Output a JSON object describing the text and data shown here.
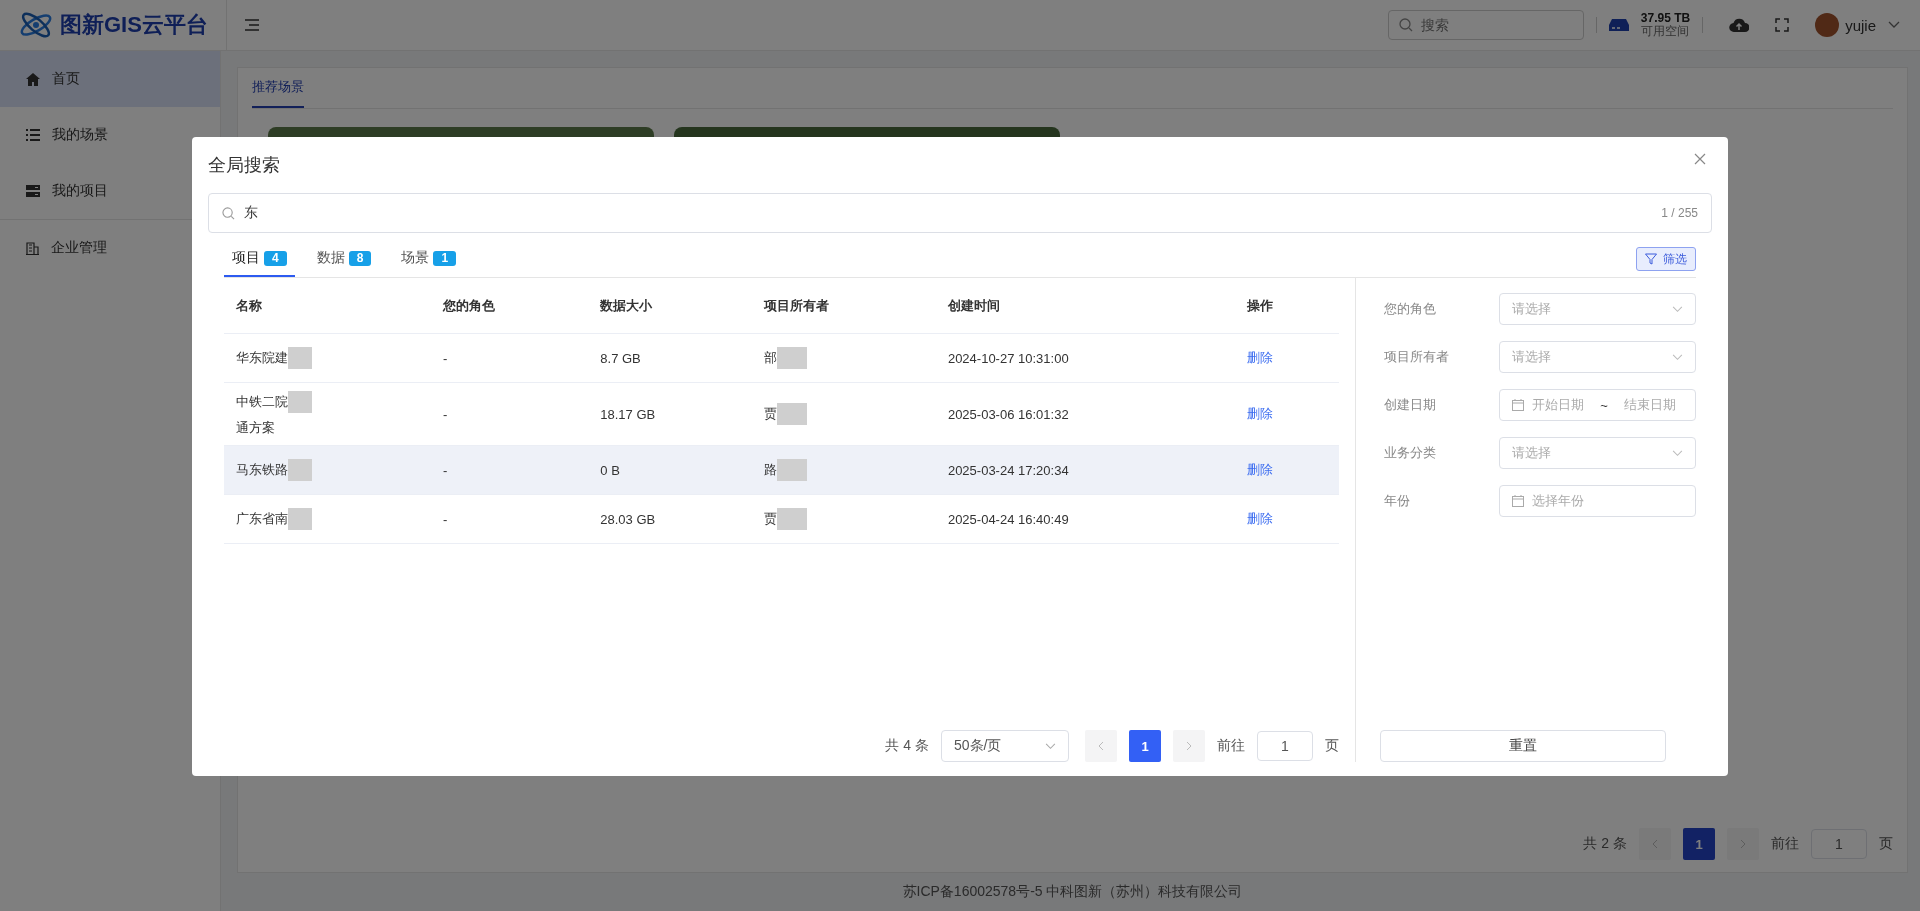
{
  "header": {
    "logo": "图新GIS云平台",
    "search_placeholder": "搜索",
    "storage_value": "37.95 TB",
    "storage_label": "可用空间",
    "user": "yujie"
  },
  "sidebar": {
    "items": [
      {
        "label": "首页",
        "selected": true
      },
      {
        "label": "我的场景",
        "selected": false
      },
      {
        "label": "我的项目",
        "selected": false
      },
      {
        "label": "企业管理",
        "selected": false
      }
    ]
  },
  "page": {
    "tabs": [
      {
        "label": "推荐场景",
        "selected": true
      }
    ],
    "pagination": {
      "total": "共 2 条",
      "current": "1",
      "goto_label": "前往",
      "goto_value": "1",
      "page_unit": "页"
    },
    "footer": "苏ICP备16002578号-5 中科图新（苏州）科技有限公司"
  },
  "dialog": {
    "title": "全局搜索",
    "search_value": "东",
    "search_count": "1 / 255",
    "tabs": [
      {
        "label": "项目",
        "count": "4",
        "selected": true
      },
      {
        "label": "数据",
        "count": "8",
        "selected": false
      },
      {
        "label": "场景",
        "count": "1",
        "selected": false
      }
    ],
    "filter_button": "筛选",
    "table": {
      "columns": [
        "名称",
        "您的角色",
        "数据大小",
        "项目所有者",
        "创建时间",
        "操作"
      ],
      "rows": [
        {
          "name": "华东院建",
          "role": "-",
          "size": "8.7 GB",
          "owner": "部",
          "created": "2024-10-27 10:31:00",
          "action": "删除",
          "hovered": false
        },
        {
          "name": "中铁二院",
          "name_line2": "通方案",
          "role": "-",
          "size": "18.17 GB",
          "owner": "贾",
          "created": "2025-03-06 16:01:32",
          "action": "删除",
          "hovered": false
        },
        {
          "name": "马东铁路",
          "role": "-",
          "size": "0 B",
          "owner": "路",
          "created": "2025-03-24 17:20:34",
          "action": "删除",
          "hovered": true
        },
        {
          "name": "广东省南",
          "role": "-",
          "size": "28.03 GB",
          "owner": "贾",
          "created": "2025-04-24 16:40:49",
          "action": "删除",
          "hovered": false
        }
      ]
    },
    "pagination": {
      "total": "共 4 条",
      "page_size": "50条/页",
      "current": "1",
      "goto_label": "前往",
      "goto_value": "1",
      "page_unit": "页"
    },
    "filters": [
      {
        "label": "您的角色",
        "kind": "select",
        "placeholder": "请选择"
      },
      {
        "label": "项目所有者",
        "kind": "select",
        "placeholder": "请选择"
      },
      {
        "label": "创建日期",
        "kind": "daterange",
        "placeholder": "开始日期",
        "separator": "~",
        "placeholder_end": "结束日期"
      },
      {
        "label": "业务分类",
        "kind": "select",
        "placeholder": "请选择"
      },
      {
        "label": "年份",
        "kind": "year",
        "placeholder": "选择年份"
      }
    ],
    "reset_button": "重置"
  }
}
